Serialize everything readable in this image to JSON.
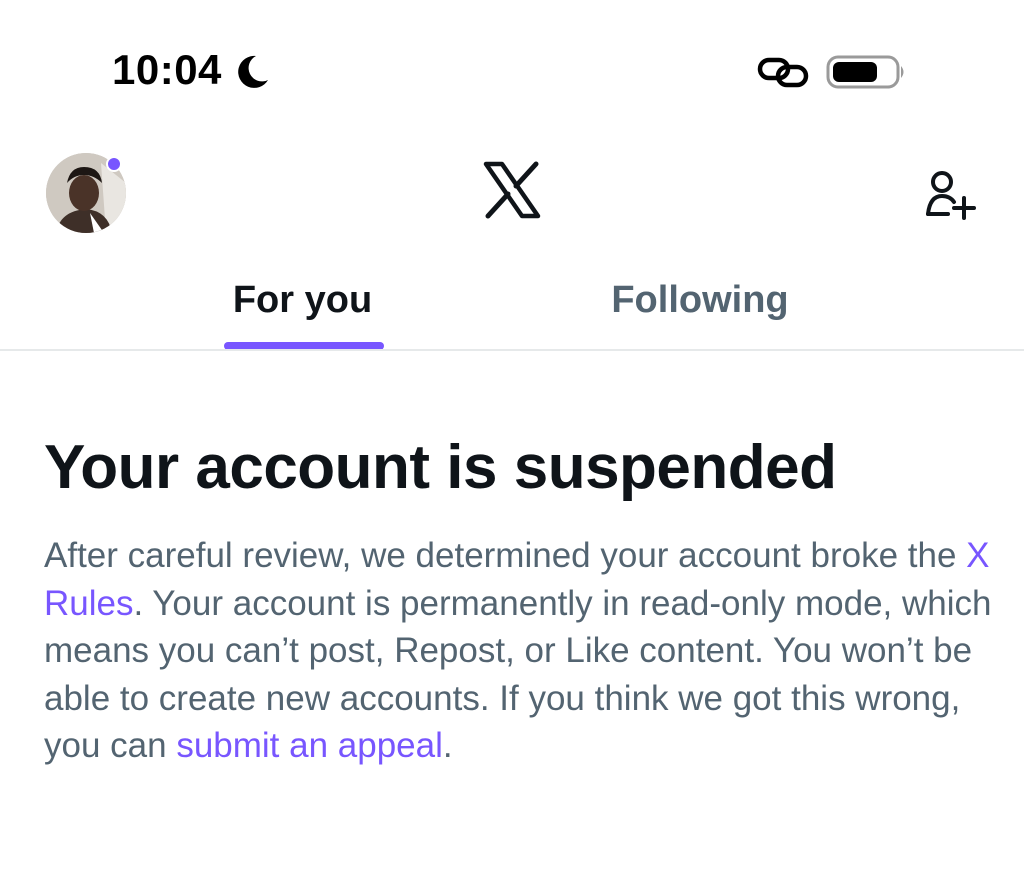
{
  "status_bar": {
    "time": "10:04",
    "icons": [
      "moon-icon",
      "link-icon",
      "battery-icon"
    ]
  },
  "header": {
    "avatar": "avatar",
    "logo": "x-logo-icon",
    "right_icon": "add-user-icon"
  },
  "tabs": [
    {
      "label": "For you",
      "active": true
    },
    {
      "label": "Following",
      "active": false
    }
  ],
  "notice": {
    "title": "Your account is suspended",
    "body_1": "After careful review, we determined your account broke the ",
    "link_rules": "X Rules",
    "body_2": ". Your account is permanently in read-only mode, which means you can’t post, Repost, or Like content. You won’t be able to create new accounts. If you think we got this wrong, you can ",
    "link_appeal": "submit an appeal",
    "body_3": "."
  },
  "colors": {
    "accent": "#7856ff",
    "text_primary": "#0f1419",
    "text_secondary": "#536471",
    "divider": "#e6e9ea"
  }
}
